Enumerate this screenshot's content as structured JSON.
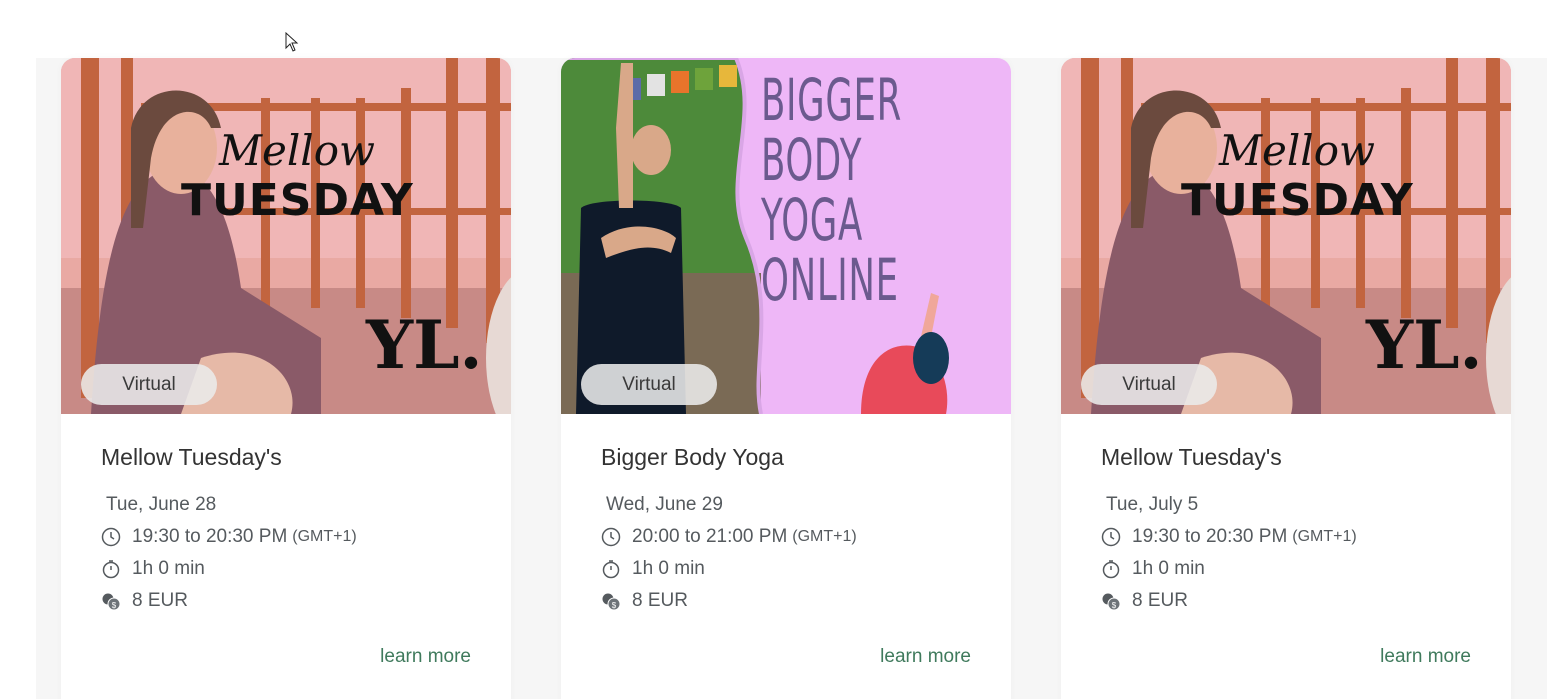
{
  "cards": [
    {
      "badge": "Virtual",
      "image_script_text": "Mellow",
      "image_big_text": "TUESDAY",
      "image_logo_text": "YL.",
      "title": "Mellow Tuesday's",
      "date": "Tue, June 28",
      "time": "19:30 to 20:30 PM",
      "timezone": "(GMT+1)",
      "duration": "1h 0 min",
      "price": "8 EUR",
      "learn_more": "learn more"
    },
    {
      "badge": "Virtual",
      "image_poster_text": "BIGGER\nBODY\nYOGA\nONLINE",
      "title": "Bigger Body Yoga",
      "date": "Wed, June 29",
      "time": "20:00 to 21:00 PM",
      "timezone": "(GMT+1)",
      "duration": "1h 0 min",
      "price": "8 EUR",
      "learn_more": "learn more"
    },
    {
      "badge": "Virtual",
      "image_script_text": "Mellow",
      "image_big_text": "TUESDAY",
      "image_logo_text": "YL.",
      "title": "Mellow Tuesday's",
      "date": "Tue, July 5",
      "time": "19:30 to 20:30 PM",
      "timezone": "(GMT+1)",
      "duration": "1h 0 min",
      "price": "8 EUR",
      "learn_more": "learn more"
    }
  ],
  "colors": {
    "link": "#3f7a5c",
    "pink_overlay": "#f2b8b8",
    "lavender": "#eeb7f7",
    "text_muted": "#555a5e"
  },
  "icons": [
    "clock-icon",
    "stopwatch-icon",
    "coins-icon"
  ]
}
